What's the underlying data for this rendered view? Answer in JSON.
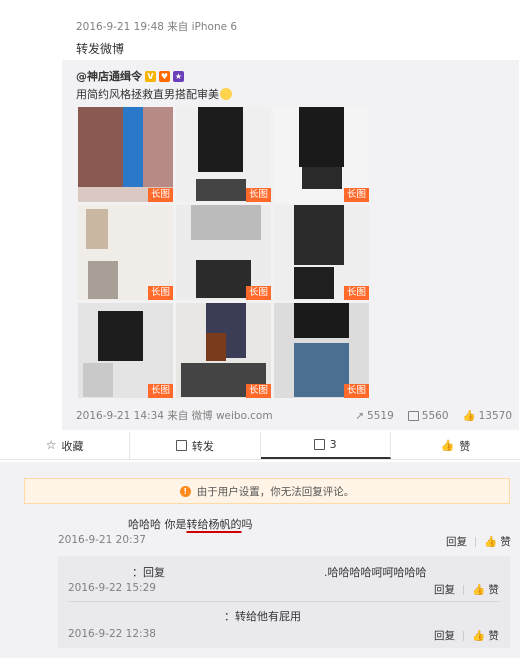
{
  "post": {
    "meta": "2016-9-21 19:48 来自 iPhone 6",
    "text": "转发微博"
  },
  "original": {
    "author": "@神店通缉令",
    "text": "用简约风格拯救直男搭配审美",
    "long_tag": "长图",
    "date_source": "2016-9-21 14:34 来自 微博 weibo.com",
    "reposts": "5519",
    "comments": "5560",
    "likes": "13570"
  },
  "actions": {
    "favorite": "收藏",
    "repost": "转发",
    "comment": "3",
    "like": "赞"
  },
  "comments": {
    "notice": "由于用户设置，你无法回复评论。",
    "c1_text_pre": "哈哈哈 你是",
    "c1_text_mid": "转给杨帆的",
    "c1_text_post": "吗",
    "c1_date": "2016-9-21 20:37",
    "reply_label": "回复",
    "like_label": "赞",
    "r1_text_a": "：回复",
    "r1_text_b": ".哈哈哈哈呵呵哈哈哈",
    "r1_date": "2016-9-22 15:29",
    "r2_text": "：转给他有屁用",
    "r2_date": "2016-9-22 12:38"
  },
  "colors": {
    "long_tag_bg": "#ff6a2b",
    "notice_icon": "#ff8a1a",
    "underline": "#cc0000"
  }
}
